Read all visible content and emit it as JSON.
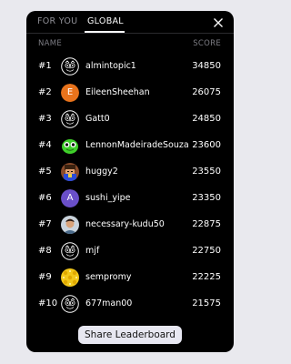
{
  "tabs": {
    "for_you": "FOR YOU",
    "global": "GLOBAL"
  },
  "header": {
    "name": "NAME",
    "score": "SCORE"
  },
  "colors": {
    "panel_bg": "#000000",
    "avatar_orange": "#e8731c",
    "avatar_purple": "#6a4fc9"
  },
  "leaderboard": [
    {
      "rank": "#1",
      "name": "almintopic1",
      "score": "34850",
      "avatar": "owl-icon"
    },
    {
      "rank": "#2",
      "name": "EileenSheehan",
      "score": "26075",
      "avatar": "letter",
      "letter": "E"
    },
    {
      "rank": "#3",
      "name": "Gatt0",
      "score": "24850",
      "avatar": "owl-icon"
    },
    {
      "rank": "#4",
      "name": "LennonMadeiradeSouza",
      "score": "23600",
      "avatar": "green-creature-icon"
    },
    {
      "rank": "#5",
      "name": "huggy2",
      "score": "23550",
      "avatar": "pixel-character-icon"
    },
    {
      "rank": "#6",
      "name": "sushi_yipe",
      "score": "23350",
      "avatar": "letter",
      "letter": "A"
    },
    {
      "rank": "#7",
      "name": "necessary-kudu50",
      "score": "22875",
      "avatar": "person-photo"
    },
    {
      "rank": "#8",
      "name": "mjf",
      "score": "22750",
      "avatar": "owl-icon"
    },
    {
      "rank": "#9",
      "name": "sempromy",
      "score": "22225",
      "avatar": "yellow-pattern-icon"
    },
    {
      "rank": "#10",
      "name": "677man00",
      "score": "21575",
      "avatar": "owl-icon"
    }
  ],
  "share_button": "Share Leaderboard"
}
